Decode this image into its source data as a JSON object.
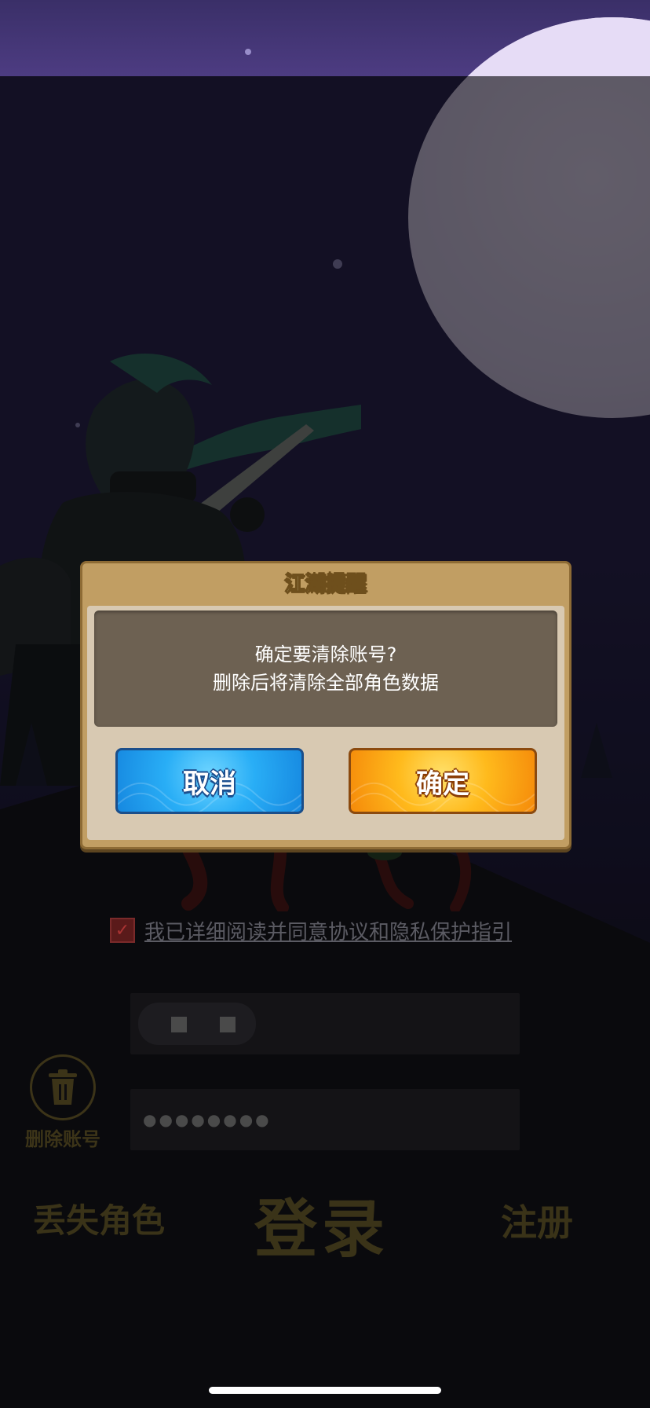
{
  "dialog": {
    "title": "江湖提醒",
    "message_line1": "确定要清除账号?",
    "message_line2": "删除后将清除全部角色数据",
    "cancel_label": "取消",
    "confirm_label": "确定"
  },
  "login": {
    "agreement_text": "我已详细阅读并同意协议和隐私保护指引",
    "password_mask": "●●●●●●●●",
    "delete_account_label": "删除账号",
    "lost_role_label": "丢失角色",
    "login_label": "登录",
    "register_label": "注册"
  },
  "colors": {
    "dialog_frame": "#c19e63",
    "message_bg": "#6d6152",
    "cancel_blue": "#29aef6",
    "confirm_orange": "#ffba1c"
  },
  "icons": {
    "delete_account": "trash-icon"
  }
}
